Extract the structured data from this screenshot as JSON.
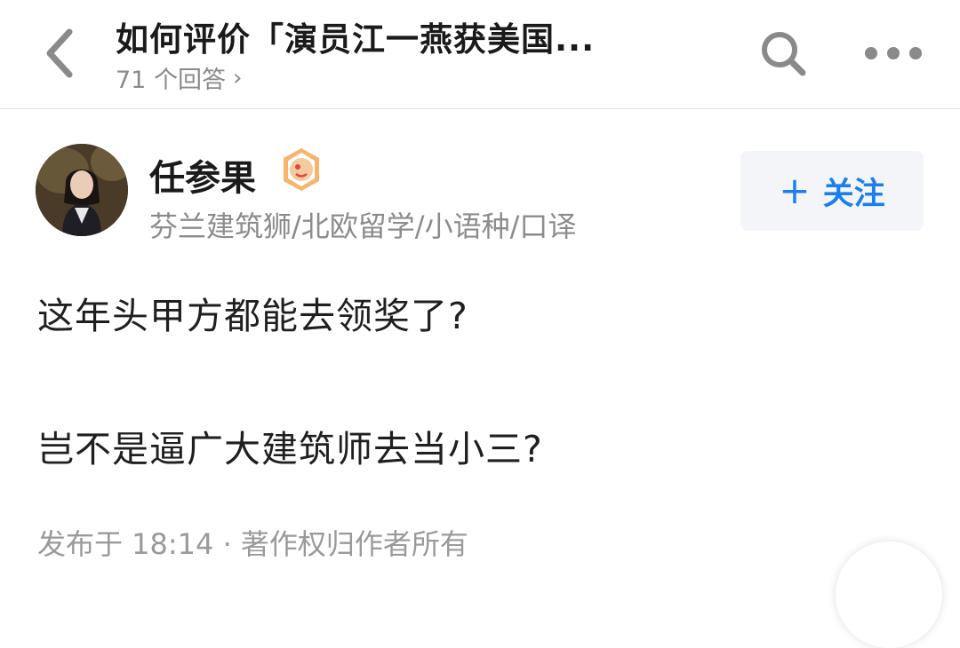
{
  "header": {
    "title": "如何评价「演员江一燕获美国...",
    "answer_count": "71 个回答",
    "chevron": "›",
    "back_icon": "chevron-left-icon",
    "search_icon": "search-icon",
    "more_icon": "more-icon"
  },
  "author": {
    "name": "任参果",
    "bio": "芬兰建筑狮/北欧留学/小语种/口译",
    "badge_icon": "verified-badge-icon"
  },
  "follow_button": {
    "plus": "+",
    "label": "关注"
  },
  "content": {
    "paragraphs": [
      "这年头甲方都能去领奖了?",
      "岂不是逼广大建筑师去当小三?"
    ]
  },
  "meta": {
    "text": "发布于 18:14 · 著作权归作者所有"
  },
  "colors": {
    "accent": "#1c7ff0",
    "muted": "#8c8c8c",
    "badge": "#f07a2e"
  }
}
